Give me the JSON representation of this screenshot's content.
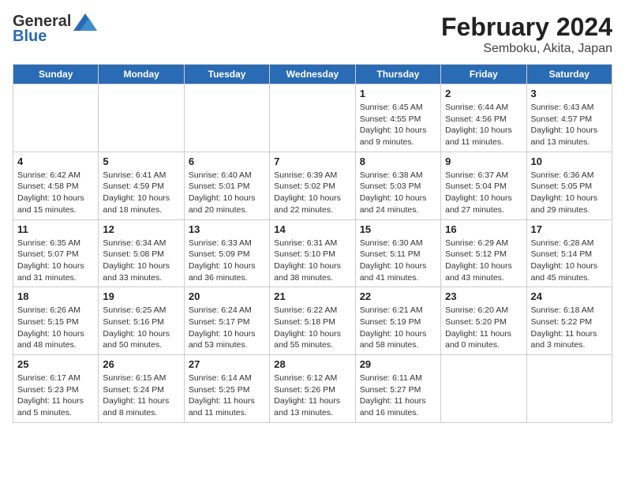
{
  "header": {
    "logo_general": "General",
    "logo_blue": "Blue",
    "title": "February 2024",
    "subtitle": "Semboku, Akita, Japan"
  },
  "weekdays": [
    "Sunday",
    "Monday",
    "Tuesday",
    "Wednesday",
    "Thursday",
    "Friday",
    "Saturday"
  ],
  "weeks": [
    [
      {
        "day": "",
        "info": ""
      },
      {
        "day": "",
        "info": ""
      },
      {
        "day": "",
        "info": ""
      },
      {
        "day": "",
        "info": ""
      },
      {
        "day": "1",
        "info": "Sunrise: 6:45 AM\nSunset: 4:55 PM\nDaylight: 10 hours\nand 9 minutes."
      },
      {
        "day": "2",
        "info": "Sunrise: 6:44 AM\nSunset: 4:56 PM\nDaylight: 10 hours\nand 11 minutes."
      },
      {
        "day": "3",
        "info": "Sunrise: 6:43 AM\nSunset: 4:57 PM\nDaylight: 10 hours\nand 13 minutes."
      }
    ],
    [
      {
        "day": "4",
        "info": "Sunrise: 6:42 AM\nSunset: 4:58 PM\nDaylight: 10 hours\nand 15 minutes."
      },
      {
        "day": "5",
        "info": "Sunrise: 6:41 AM\nSunset: 4:59 PM\nDaylight: 10 hours\nand 18 minutes."
      },
      {
        "day": "6",
        "info": "Sunrise: 6:40 AM\nSunset: 5:01 PM\nDaylight: 10 hours\nand 20 minutes."
      },
      {
        "day": "7",
        "info": "Sunrise: 6:39 AM\nSunset: 5:02 PM\nDaylight: 10 hours\nand 22 minutes."
      },
      {
        "day": "8",
        "info": "Sunrise: 6:38 AM\nSunset: 5:03 PM\nDaylight: 10 hours\nand 24 minutes."
      },
      {
        "day": "9",
        "info": "Sunrise: 6:37 AM\nSunset: 5:04 PM\nDaylight: 10 hours\nand 27 minutes."
      },
      {
        "day": "10",
        "info": "Sunrise: 6:36 AM\nSunset: 5:05 PM\nDaylight: 10 hours\nand 29 minutes."
      }
    ],
    [
      {
        "day": "11",
        "info": "Sunrise: 6:35 AM\nSunset: 5:07 PM\nDaylight: 10 hours\nand 31 minutes."
      },
      {
        "day": "12",
        "info": "Sunrise: 6:34 AM\nSunset: 5:08 PM\nDaylight: 10 hours\nand 33 minutes."
      },
      {
        "day": "13",
        "info": "Sunrise: 6:33 AM\nSunset: 5:09 PM\nDaylight: 10 hours\nand 36 minutes."
      },
      {
        "day": "14",
        "info": "Sunrise: 6:31 AM\nSunset: 5:10 PM\nDaylight: 10 hours\nand 38 minutes."
      },
      {
        "day": "15",
        "info": "Sunrise: 6:30 AM\nSunset: 5:11 PM\nDaylight: 10 hours\nand 41 minutes."
      },
      {
        "day": "16",
        "info": "Sunrise: 6:29 AM\nSunset: 5:12 PM\nDaylight: 10 hours\nand 43 minutes."
      },
      {
        "day": "17",
        "info": "Sunrise: 6:28 AM\nSunset: 5:14 PM\nDaylight: 10 hours\nand 45 minutes."
      }
    ],
    [
      {
        "day": "18",
        "info": "Sunrise: 6:26 AM\nSunset: 5:15 PM\nDaylight: 10 hours\nand 48 minutes."
      },
      {
        "day": "19",
        "info": "Sunrise: 6:25 AM\nSunset: 5:16 PM\nDaylight: 10 hours\nand 50 minutes."
      },
      {
        "day": "20",
        "info": "Sunrise: 6:24 AM\nSunset: 5:17 PM\nDaylight: 10 hours\nand 53 minutes."
      },
      {
        "day": "21",
        "info": "Sunrise: 6:22 AM\nSunset: 5:18 PM\nDaylight: 10 hours\nand 55 minutes."
      },
      {
        "day": "22",
        "info": "Sunrise: 6:21 AM\nSunset: 5:19 PM\nDaylight: 10 hours\nand 58 minutes."
      },
      {
        "day": "23",
        "info": "Sunrise: 6:20 AM\nSunset: 5:20 PM\nDaylight: 11 hours\nand 0 minutes."
      },
      {
        "day": "24",
        "info": "Sunrise: 6:18 AM\nSunset: 5:22 PM\nDaylight: 11 hours\nand 3 minutes."
      }
    ],
    [
      {
        "day": "25",
        "info": "Sunrise: 6:17 AM\nSunset: 5:23 PM\nDaylight: 11 hours\nand 5 minutes."
      },
      {
        "day": "26",
        "info": "Sunrise: 6:15 AM\nSunset: 5:24 PM\nDaylight: 11 hours\nand 8 minutes."
      },
      {
        "day": "27",
        "info": "Sunrise: 6:14 AM\nSunset: 5:25 PM\nDaylight: 11 hours\nand 11 minutes."
      },
      {
        "day": "28",
        "info": "Sunrise: 6:12 AM\nSunset: 5:26 PM\nDaylight: 11 hours\nand 13 minutes."
      },
      {
        "day": "29",
        "info": "Sunrise: 6:11 AM\nSunset: 5:27 PM\nDaylight: 11 hours\nand 16 minutes."
      },
      {
        "day": "",
        "info": ""
      },
      {
        "day": "",
        "info": ""
      }
    ]
  ]
}
